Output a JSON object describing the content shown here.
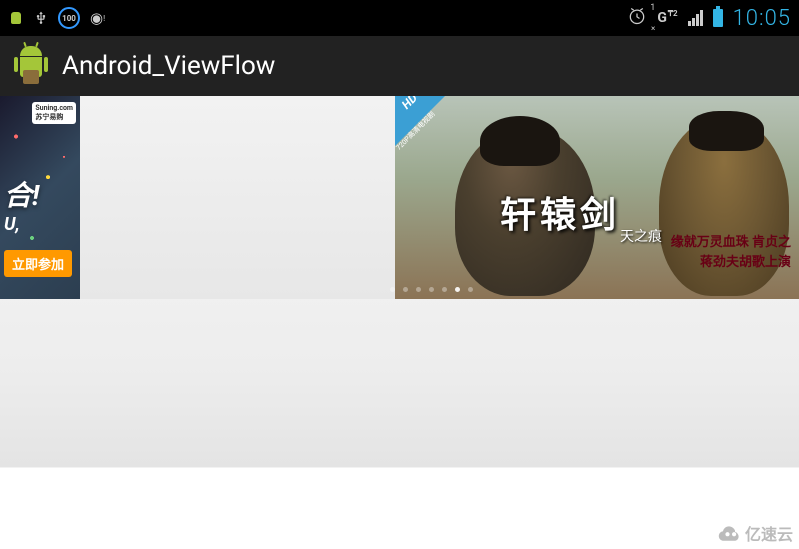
{
  "status_bar": {
    "badge_100": "100",
    "alarm_sup": "1",
    "alarm_sub": "×",
    "connection_label": "G",
    "connection_sup": "₸2",
    "clock": "10:05"
  },
  "title_bar": {
    "app_title": "Android_ViewFlow"
  },
  "viewflow": {
    "left_slide": {
      "brand": "Suning.com",
      "brand_cn": "苏宁易购",
      "headline": "合!",
      "subline": "U,",
      "button": "立即参加"
    },
    "right_slide": {
      "hd_label": "HD",
      "quality_label": "720P高清电视剧",
      "title": "轩辕剑",
      "subtitle": "天之痕",
      "line1": "缘就万灵血珠 肯贞之",
      "line2": "蒋劲夫胡歌上演"
    },
    "dots": {
      "count": 7,
      "active_index": 5
    }
  },
  "watermark": "亿速云"
}
